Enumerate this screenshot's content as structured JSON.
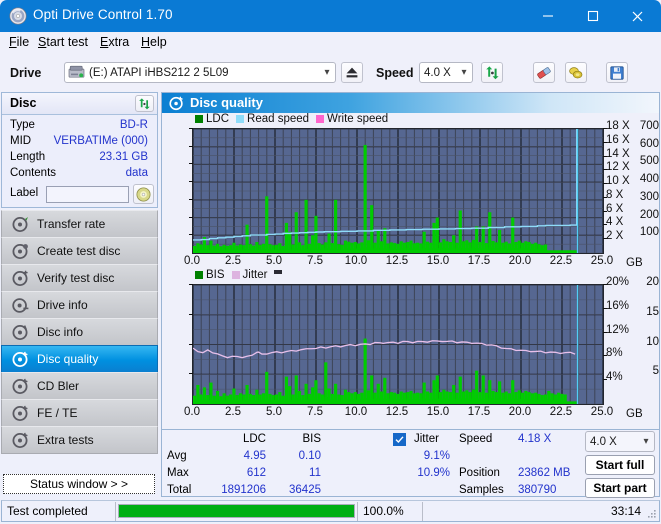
{
  "window": {
    "title": "Opti Drive Control 1.70",
    "icon": "disc-icon",
    "minimize_label": "–",
    "maximize_label": "□",
    "close_label": "✕"
  },
  "menu": [
    {
      "label": "File",
      "accel": "F"
    },
    {
      "label": "Start test",
      "accel": "S"
    },
    {
      "label": "Extra",
      "accel": "E"
    },
    {
      "label": "Help",
      "accel": "H"
    }
  ],
  "toolbar": {
    "drive_label": "Drive",
    "drive_value": "(E:)  ATAPI iHBS212  2 5L09",
    "drive_icon": "drive-icon",
    "eject_icon": "eject-icon",
    "speed_label": "Speed",
    "speed_value": "4.0 X",
    "refresh_icon": "refresh-icon",
    "erase_icon": "eraser-icon",
    "bitsetting_icon": "coins-icon",
    "save_icon": "floppy-save-icon"
  },
  "sidebar": {
    "disc_panel": {
      "header": "Disc",
      "refresh_icon": "refresh-icon",
      "rows": [
        {
          "key": "Type",
          "value": "BD-R"
        },
        {
          "key": "MID",
          "value": "VERBATIMe (000)"
        },
        {
          "key": "Length",
          "value": "23.31 GB"
        },
        {
          "key": "Contents",
          "value": "data"
        }
      ],
      "label_key": "Label",
      "label_value": "",
      "label_placeholder": "",
      "label_button_icon": "disc-label-icon"
    },
    "nav": [
      {
        "label": "Transfer rate",
        "icon": "disc-read-icon",
        "selected": false
      },
      {
        "label": "Create test disc",
        "icon": "disc-burn-icon",
        "selected": false
      },
      {
        "label": "Verify test disc",
        "icon": "disc-verify-icon",
        "selected": false
      },
      {
        "label": "Drive info",
        "icon": "drive-info-icon",
        "selected": false
      },
      {
        "label": "Disc info",
        "icon": "disc-info-icon",
        "selected": false
      },
      {
        "label": "Disc quality",
        "icon": "disc-quality-icon",
        "selected": true
      },
      {
        "label": "CD Bler",
        "icon": "disc-bler-icon",
        "selected": false
      },
      {
        "label": "FE / TE",
        "icon": "disc-fete-icon",
        "selected": false
      },
      {
        "label": "Extra tests",
        "icon": "disc-extra-icon",
        "selected": false
      }
    ],
    "status_window_button": "Status window > >"
  },
  "main": {
    "header": "Disc quality",
    "header_icon": "disc-quality-icon"
  },
  "chart_data": [
    {
      "id": "ldc-chart",
      "type": "area",
      "title": "",
      "legend": [
        {
          "label": "LDC",
          "color": "#00a000"
        },
        {
          "label": "Read speed",
          "color": "#7fd4f7"
        },
        {
          "label": "Write speed",
          "color": "#ff66cc"
        }
      ],
      "legend_position": "top-left",
      "grid": true,
      "xlabel": "GB",
      "xlim": [
        0,
        25
      ],
      "xticks": [
        "0.0",
        "2.5",
        "5.0",
        "7.5",
        "10.0",
        "12.5",
        "15.0",
        "17.5",
        "20.0",
        "22.5",
        "25.0"
      ],
      "ylabel_left": "",
      "ylim_left": [
        0,
        700
      ],
      "yticks_left": [
        "700",
        "600",
        "500",
        "400",
        "300",
        "200",
        "100"
      ],
      "ylabel_right": "",
      "ylim_right": [
        0,
        18
      ],
      "yticks_right": [
        "18 X",
        "16 X",
        "14 X",
        "12 X",
        "10 X",
        "8 X",
        "6 X",
        "4 X",
        "2 X"
      ],
      "plot_bg": "#566791",
      "series": [
        {
          "name": "LDC",
          "color": "#00cc00",
          "kind": "spiked-area",
          "x": [
            0.0,
            0.2,
            0.4,
            0.6,
            0.8,
            1.0,
            1.2,
            1.4,
            1.6,
            1.8,
            2.0,
            2.2,
            2.4,
            2.6,
            2.8,
            3.0,
            3.2,
            3.4,
            3.6,
            3.8,
            4.0,
            4.2,
            4.4,
            4.6,
            4.8,
            5.0,
            5.2,
            5.4,
            5.6,
            5.8,
            6.0,
            6.2,
            6.4,
            6.6,
            6.8,
            7.0,
            7.2,
            7.4,
            7.6,
            7.8,
            8.0,
            8.2,
            8.4,
            8.6,
            8.8,
            9.0,
            9.2,
            9.4,
            9.6,
            9.8,
            10.0,
            10.2,
            10.4,
            10.6,
            10.8,
            11.0,
            11.2,
            11.4,
            11.6,
            11.8,
            12.0,
            12.2,
            12.4,
            12.6,
            12.8,
            13.0,
            13.2,
            13.4,
            13.6,
            13.8,
            14.0,
            14.2,
            14.4,
            14.6,
            14.8,
            15.0,
            15.2,
            15.4,
            15.6,
            15.8,
            16.0,
            16.2,
            16.4,
            16.6,
            16.8,
            17.0,
            17.2,
            17.4,
            17.6,
            17.8,
            18.0,
            18.2,
            18.4,
            18.6,
            18.8,
            19.0,
            19.2,
            19.4,
            19.6,
            19.8,
            20.0,
            20.2,
            20.4,
            20.6,
            20.8,
            21.0,
            21.2,
            21.4,
            21.6,
            21.8,
            22.0,
            22.2,
            22.4,
            22.6,
            22.8,
            23.0,
            23.2,
            23.4
          ],
          "values": [
            40,
            55,
            48,
            90,
            44,
            70,
            42,
            52,
            38,
            46,
            40,
            44,
            58,
            42,
            48,
            44,
            160,
            50,
            42,
            62,
            46,
            52,
            320,
            50,
            44,
            46,
            55,
            40,
            170,
            120,
            48,
            230,
            60,
            44,
            300,
            52,
            100,
            210,
            56,
            48,
            60,
            110,
            56,
            300,
            50,
            46,
            70,
            64,
            58,
            62,
            54,
            60,
            610,
            72,
            270,
            58,
            130,
            66,
            140,
            54,
            60,
            56,
            52,
            66,
            58,
            62,
            70,
            55,
            58,
            54,
            120,
            64,
            58,
            170,
            200,
            60,
            78,
            66,
            62,
            100,
            58,
            240,
            66,
            72,
            60,
            74,
            150,
            62,
            150,
            56,
            230,
            68,
            60,
            130,
            58,
            64,
            54,
            200,
            62,
            70,
            58,
            66,
            62,
            52,
            58,
            50,
            44,
            48
          ]
        },
        {
          "name": "Read speed",
          "color": "#8fdcf9",
          "kind": "step-line",
          "x": [
            0.0,
            0.5,
            1.0,
            1.5,
            2.0,
            2.5,
            3.0,
            3.5,
            4.0,
            4.5,
            5.0,
            5.5,
            6.0,
            6.5,
            7.0,
            7.5,
            8.0,
            9.0,
            10.0,
            11.0,
            12.0,
            13.0,
            14.0,
            15.0,
            16.0,
            17.0,
            18.0,
            19.0,
            20.0,
            21.0,
            21.5,
            23.0,
            23.4,
            23.4
          ],
          "values": [
            1.9,
            1.95,
            2.1,
            2.2,
            2.3,
            2.4,
            2.5,
            2.6,
            2.6,
            2.7,
            2.75,
            2.85,
            2.9,
            2.95,
            3.0,
            3.05,
            3.1,
            3.15,
            3.2,
            3.3,
            3.35,
            3.4,
            3.45,
            3.5,
            3.55,
            3.6,
            3.7,
            3.8,
            3.85,
            3.95,
            4.0,
            4.05,
            4.05,
            18.0
          ]
        },
        {
          "name": "Write speed",
          "color": "#ff66cc",
          "kind": "line",
          "x": [],
          "values": []
        }
      ]
    },
    {
      "id": "bis-jitter-chart",
      "type": "area",
      "title": "",
      "legend": [
        {
          "label": "BIS",
          "color": "#00a000"
        },
        {
          "label": "Jitter",
          "color": "#ddb4e0"
        },
        {
          "label": "",
          "color": "#2b2b33"
        }
      ],
      "legend_position": "top-left",
      "grid": true,
      "xlabel": "GB",
      "xlim": [
        0,
        25
      ],
      "xticks": [
        "0.0",
        "2.5",
        "5.0",
        "7.5",
        "10.0",
        "12.5",
        "15.0",
        "17.5",
        "20.0",
        "22.5",
        "25.0"
      ],
      "ylabel_left": "",
      "ylim_left": [
        0,
        20
      ],
      "yticks_left": [
        "20",
        "15",
        "10",
        "5"
      ],
      "ylabel_right": "",
      "ylim_right": [
        0,
        20
      ],
      "yticks_right": [
        "20%",
        "16%",
        "12%",
        "8%",
        "4%"
      ],
      "plot_bg": "#566791",
      "series": [
        {
          "name": "BIS",
          "color": "#00cc00",
          "kind": "spiked-area",
          "x": [
            0.0,
            0.2,
            0.4,
            0.6,
            0.8,
            1.0,
            1.2,
            1.4,
            1.6,
            1.8,
            2.0,
            2.2,
            2.4,
            2.6,
            2.8,
            3.0,
            3.2,
            3.4,
            3.6,
            3.8,
            4.0,
            4.2,
            4.4,
            4.6,
            4.8,
            5.0,
            5.2,
            5.4,
            5.6,
            5.8,
            6.0,
            6.2,
            6.4,
            6.6,
            6.8,
            7.0,
            7.2,
            7.4,
            7.6,
            7.8,
            8.0,
            8.2,
            8.4,
            8.6,
            8.8,
            9.0,
            9.2,
            9.4,
            9.6,
            9.8,
            10.0,
            10.2,
            10.4,
            10.6,
            10.8,
            11.0,
            11.2,
            11.4,
            11.6,
            11.8,
            12.0,
            12.2,
            12.4,
            12.6,
            12.8,
            13.0,
            13.2,
            13.4,
            13.6,
            13.8,
            14.0,
            14.2,
            14.4,
            14.6,
            14.8,
            15.0,
            15.2,
            15.4,
            15.6,
            15.8,
            16.0,
            16.2,
            16.4,
            16.6,
            16.8,
            17.0,
            17.2,
            17.4,
            17.6,
            17.8,
            18.0,
            18.2,
            18.4,
            18.6,
            18.8,
            19.0,
            19.2,
            19.4,
            19.6,
            19.8,
            20.0,
            20.2,
            20.4,
            20.6,
            20.8,
            21.0,
            21.2,
            21.4,
            21.6,
            21.8,
            22.0,
            22.2,
            22.4,
            22.6,
            22.8,
            23.0,
            23.2,
            23.4
          ],
          "values": [
            1.4,
            3.2,
            1.6,
            2.8,
            1.5,
            3.6,
            1.4,
            2.2,
            1.3,
            1.8,
            1.4,
            1.6,
            2.6,
            1.5,
            1.8,
            1.6,
            3.2,
            1.7,
            1.5,
            2.4,
            1.6,
            1.8,
            5.4,
            1.7,
            1.5,
            1.6,
            2.0,
            1.4,
            4.6,
            3.0,
            1.6,
            4.8,
            2.2,
            1.5,
            3.4,
            1.7,
            2.8,
            4.0,
            1.8,
            1.6,
            7.0,
            2.6,
            1.7,
            3.4,
            1.6,
            1.5,
            2.4,
            2.0,
            1.8,
            2.0,
            1.7,
            1.9,
            11.0,
            2.3,
            4.8,
            1.9,
            3.4,
            2.1,
            4.4,
            1.8,
            2.0,
            1.9,
            1.7,
            2.1,
            1.9,
            2.0,
            2.2,
            1.8,
            1.9,
            1.8,
            3.6,
            2.1,
            1.9,
            4.0,
            4.8,
            2.0,
            2.4,
            2.1,
            2.0,
            3.2,
            1.9,
            4.6,
            2.1,
            2.3,
            2.0,
            2.4,
            5.6,
            2.0,
            4.8,
            1.9,
            4.0,
            2.2,
            2.0,
            3.8,
            1.9,
            2.1,
            1.8,
            4.0,
            2.0,
            2.3,
            1.9,
            2.2,
            2.0,
            1.8,
            1.9,
            1.7,
            1.5,
            1.6,
            2.2,
            1.8,
            1.6,
            1.9,
            1.7,
            1.6
          ]
        },
        {
          "name": "Jitter",
          "color": "#e8c0ea",
          "kind": "line",
          "x": [
            0.0,
            0.3,
            0.6,
            0.9,
            1.2,
            1.5,
            1.8,
            2.1,
            2.4,
            2.7,
            3.0,
            3.3,
            3.6,
            3.9,
            4.0,
            4.2,
            4.5,
            4.8,
            5.1,
            5.4,
            5.7,
            6.0,
            6.3,
            6.6,
            6.9,
            7.2,
            7.5,
            7.8,
            8.1,
            8.4,
            8.7,
            9.0,
            9.3,
            9.6,
            9.9,
            10.2,
            10.5,
            10.8,
            11.1,
            11.4,
            11.6,
            11.9,
            12.2,
            12.5,
            12.8,
            13.1,
            13.4,
            13.7,
            14.0,
            14.3,
            14.6,
            14.9,
            15.2,
            15.5,
            15.8,
            16.1,
            16.4,
            16.7,
            17.0,
            17.3,
            17.6,
            17.9,
            18.2,
            18.5,
            18.8,
            19.1,
            19.4,
            19.7,
            20.0,
            20.3,
            20.6,
            20.9,
            21.2,
            21.5,
            21.8,
            22.1,
            22.4,
            22.7,
            23.0,
            23.3
          ],
          "values": [
            9.3,
            8.9,
            8.6,
            9.0,
            8.7,
            8.4,
            8.0,
            7.9,
            8.0,
            7.9,
            7.9,
            8.0,
            8.1,
            8.8,
            8.7,
            8.3,
            8.5,
            8.6,
            8.7,
            8.7,
            8.8,
            8.9,
            9.0,
            9.1,
            9.2,
            9.4,
            9.3,
            9.5,
            9.5,
            9.6,
            9.7,
            9.7,
            9.8,
            9.9,
            9.9,
            10.0,
            10.0,
            10.1,
            10.3,
            10.2,
            10.3,
            10.3,
            10.3,
            10.3,
            10.5,
            10.4,
            10.4,
            10.5,
            10.4,
            10.5,
            10.6,
            10.5,
            10.6,
            10.5,
            10.5,
            10.4,
            10.4,
            10.3,
            10.3,
            10.2,
            10.1,
            10.0,
            9.9,
            9.7,
            9.5,
            9.3,
            9.2,
            9.1,
            9.0,
            8.9,
            8.9,
            8.8,
            8.8,
            8.7,
            8.7,
            8.6,
            8.6,
            8.6,
            8.6,
            8.5
          ]
        }
      ]
    }
  ],
  "stats": {
    "col_headers": [
      "LDC",
      "BIS"
    ],
    "row_labels": [
      "Avg",
      "Max",
      "Total"
    ],
    "ldc": {
      "avg": "4.95",
      "max": "612",
      "total": "1891206"
    },
    "bis": {
      "avg": "0.10",
      "max": "11",
      "total": "36425"
    },
    "jitter": {
      "label": "Jitter",
      "checked": true,
      "avg": "9.1%",
      "max": "10.9%"
    },
    "speed_label": "Speed",
    "speed_value": "4.18 X",
    "position_label": "Position",
    "position_value": "23862 MB",
    "samples_label": "Samples",
    "samples_value": "380790",
    "speed_select": "4.0 X",
    "start_full_label": "Start full",
    "start_part_label": "Start part"
  },
  "statusbar": {
    "message": "Test completed",
    "progress_percent": 100.0,
    "progress_text": "100.0%",
    "elapsed": "33:14"
  },
  "colors": {
    "accent": "#0a7ad4",
    "value_text": "#2233cc",
    "plot_bg": "#566791",
    "ldc_green": "#00cc00",
    "read_speed": "#8fdcf9",
    "write_speed": "#ff66cc",
    "jitter": "#e8c0ea",
    "progress_green": "#00af14"
  }
}
